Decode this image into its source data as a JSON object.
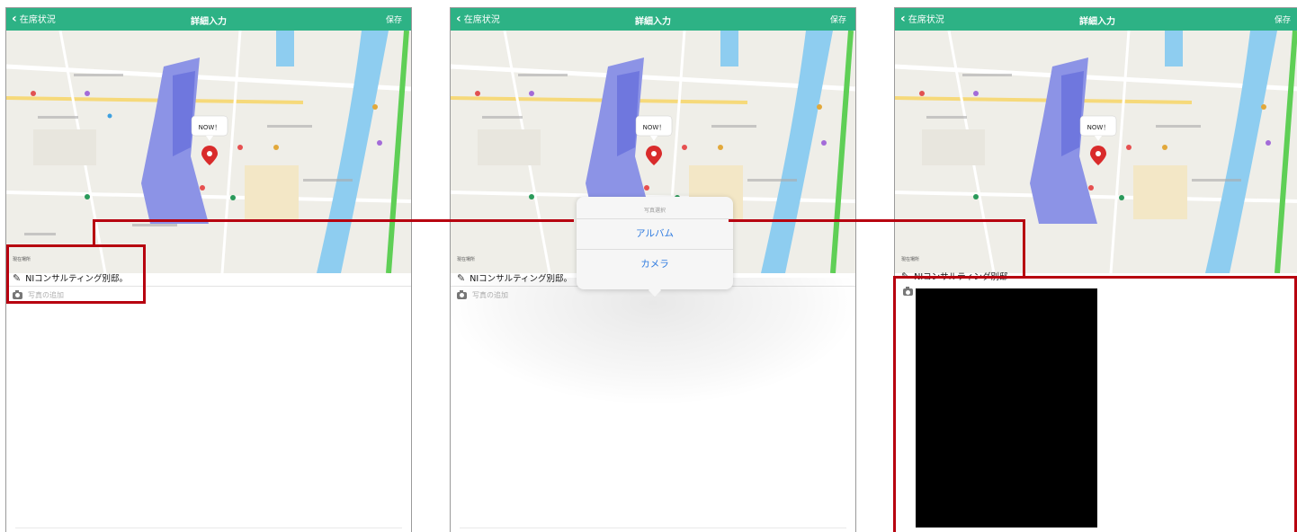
{
  "common": {
    "back_label": "在席状況",
    "title": "詳細入力",
    "save_label": "保存",
    "location_label": "現在場所",
    "place_name": "NIコンサルティング別邸。",
    "add_photo_label": "写真の追加",
    "now_label": "NOW！"
  },
  "screen3": {
    "place_name_partial": "NIコンサルティング別邸"
  },
  "popover": {
    "title": "写真選択",
    "items": [
      "アルバム",
      "カメラ"
    ]
  },
  "colors": {
    "navbar": "#2db285",
    "highlight": "#b7000f",
    "action_blue": "#2f7be0"
  },
  "icons": [
    "chevron-left-icon",
    "pencil-icon",
    "camera-icon",
    "map-pin-icon"
  ]
}
